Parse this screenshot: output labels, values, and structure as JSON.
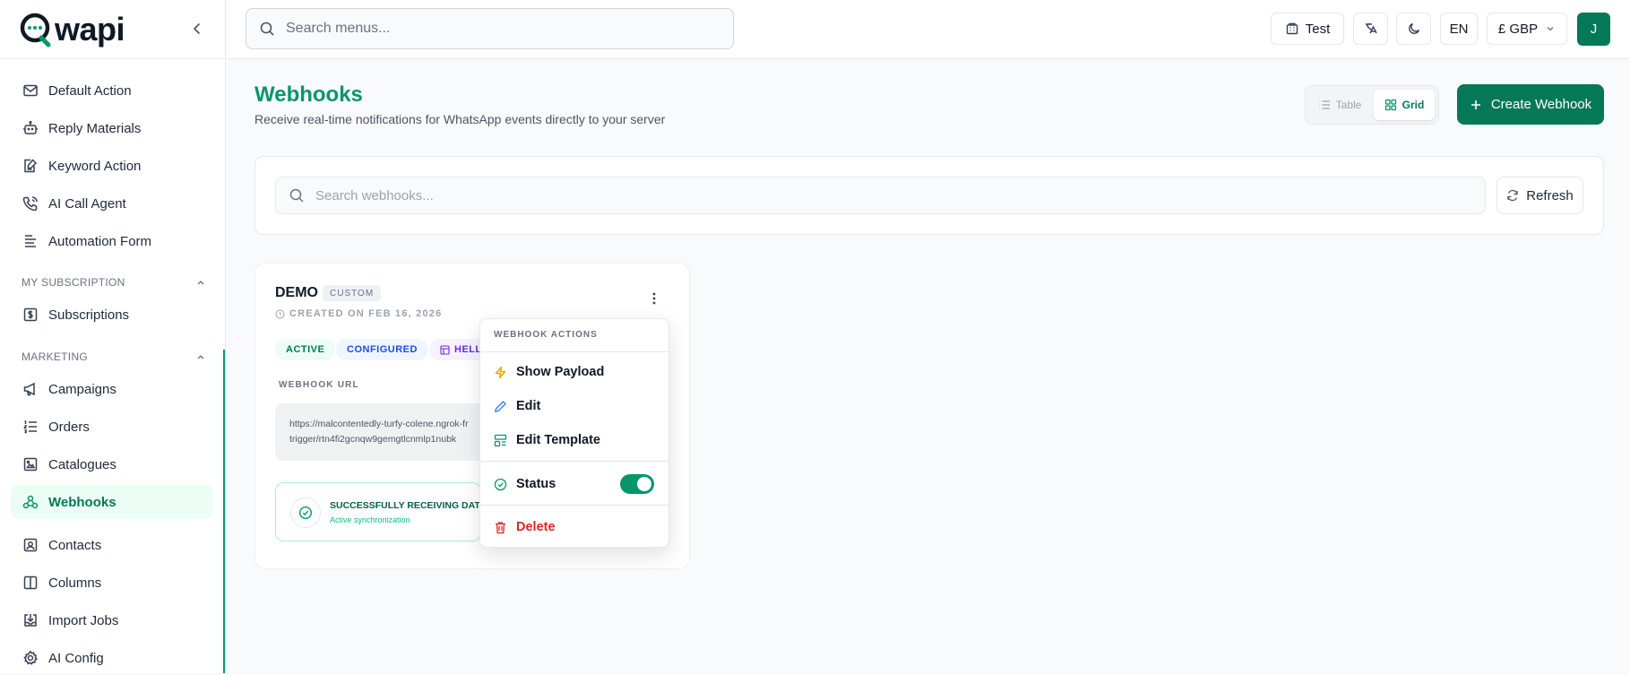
{
  "app": {
    "logo_text": "wapi",
    "logo_letter": "Q"
  },
  "sidebar": {
    "items_top": [
      {
        "label": "Default Action",
        "icon": "mail-icon"
      },
      {
        "label": "Reply Materials",
        "icon": "bot-icon"
      },
      {
        "label": "Keyword Action",
        "icon": "file-edit-icon"
      },
      {
        "label": "AI Call Agent",
        "icon": "phone-call-icon"
      },
      {
        "label": "Automation Form",
        "icon": "form-icon"
      }
    ],
    "section_subscription": "MY SUBSCRIPTION",
    "items_subscription": [
      {
        "label": "Subscriptions",
        "icon": "dollar-icon"
      }
    ],
    "section_marketing": "MARKETING",
    "items_marketing": [
      {
        "label": "Campaigns",
        "icon": "megaphone-icon"
      },
      {
        "label": "Orders",
        "icon": "list-ordered-icon"
      },
      {
        "label": "Catalogues",
        "icon": "catalogue-icon"
      },
      {
        "label": "Webhooks",
        "icon": "webhook-icon",
        "active": true
      },
      {
        "label": "Contacts",
        "icon": "contact-icon"
      },
      {
        "label": "Columns",
        "icon": "columns-icon"
      },
      {
        "label": "Import Jobs",
        "icon": "import-icon"
      },
      {
        "label": "AI Config",
        "icon": "gear-icon"
      }
    ]
  },
  "topbar": {
    "search_placeholder": "Search menus...",
    "test_label": "Test",
    "lang_label": "EN",
    "currency_label": "£ GBP",
    "avatar_initial": "J"
  },
  "page": {
    "title": "Webhooks",
    "subtitle": "Receive real-time notifications for WhatsApp events directly to your server",
    "view_table_label": "Table",
    "view_grid_label": "Grid",
    "view_selected": "Grid",
    "create_label": "Create Webhook",
    "search_placeholder": "Search webhooks...",
    "refresh_label": "Refresh"
  },
  "webhook_card": {
    "name": "DEMO",
    "type": "CUSTOM",
    "created": "CREATED ON FEB 16, 2026",
    "badges": [
      "ACTIVE",
      "CONFIGURED",
      "HELL"
    ],
    "url_label": "WEBHOOK URL",
    "url_line1": "https://malcontentedly-turfy-colene.ngrok-fr",
    "url_line2": "trigger/rtn4fi2gcnqw9gemgtlcnmlp1nubk",
    "status_title": "SUCCESSFULLY RECEIVING DAT",
    "status_sub": "Active synchronization"
  },
  "actions_menu": {
    "title": "WEBHOOK ACTIONS",
    "show_payload": "Show Payload",
    "edit": "Edit",
    "edit_template": "Edit Template",
    "status": "Status",
    "status_on": true,
    "delete": "Delete"
  },
  "colors": {
    "brand": "#047857",
    "accent": "#059669",
    "danger": "#dc2626",
    "warning": "#f59e0b"
  }
}
